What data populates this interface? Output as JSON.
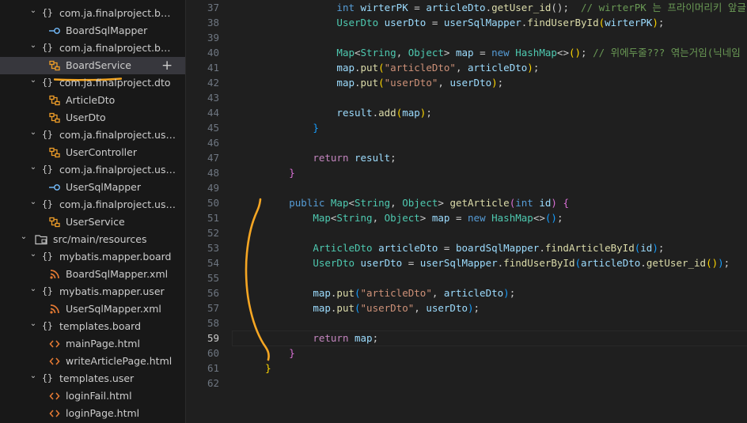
{
  "explorer": {
    "items": [
      {
        "label": "com.ja.finalproject.boar...",
        "kind": "package",
        "level": 1,
        "icon": "braces-icon"
      },
      {
        "label": "BoardSqlMapper",
        "kind": "file",
        "level": 2,
        "icon": "interface-icon",
        "icon_color": "#75beff"
      },
      {
        "label": "com.ja.finalproject.boar...",
        "kind": "package",
        "level": 1,
        "icon": "braces-icon"
      },
      {
        "label": "BoardService",
        "kind": "file",
        "level": 2,
        "icon": "class-icon",
        "icon_color": "#ee9d28",
        "selected": true,
        "action": "+"
      },
      {
        "label": "com.ja.finalproject.dto",
        "kind": "package",
        "level": 1,
        "icon": "braces-icon"
      },
      {
        "label": "ArticleDto",
        "kind": "file",
        "level": 2,
        "icon": "class-icon",
        "icon_color": "#ee9d28"
      },
      {
        "label": "UserDto",
        "kind": "file",
        "level": 2,
        "icon": "class-icon",
        "icon_color": "#ee9d28"
      },
      {
        "label": "com.ja.finalproject.user....",
        "kind": "package",
        "level": 1,
        "icon": "braces-icon"
      },
      {
        "label": "UserController",
        "kind": "file",
        "level": 2,
        "icon": "class-icon",
        "icon_color": "#ee9d28"
      },
      {
        "label": "com.ja.finalproject.user....",
        "kind": "package",
        "level": 1,
        "icon": "braces-icon"
      },
      {
        "label": "UserSqlMapper",
        "kind": "file",
        "level": 2,
        "icon": "interface-icon",
        "icon_color": "#75beff"
      },
      {
        "label": "com.ja.finalproject.user....",
        "kind": "package",
        "level": 1,
        "icon": "braces-icon"
      },
      {
        "label": "UserService",
        "kind": "file",
        "level": 2,
        "icon": "class-icon",
        "icon_color": "#ee9d28"
      },
      {
        "label": "src/main/resources",
        "kind": "folder",
        "level": 0,
        "icon": "folder-icon"
      },
      {
        "label": "mybatis.mapper.board",
        "kind": "package",
        "level": 1,
        "icon": "braces-icon"
      },
      {
        "label": "BoardSqlMapper.xml",
        "kind": "file",
        "level": 2,
        "icon": "rss-icon",
        "icon_color": "#e37933"
      },
      {
        "label": "mybatis.mapper.user",
        "kind": "package",
        "level": 1,
        "icon": "braces-icon"
      },
      {
        "label": "UserSqlMapper.xml",
        "kind": "file",
        "level": 2,
        "icon": "rss-icon",
        "icon_color": "#e37933"
      },
      {
        "label": "templates.board",
        "kind": "package",
        "level": 1,
        "icon": "braces-icon"
      },
      {
        "label": "mainPage.html",
        "kind": "file",
        "level": 2,
        "icon": "html-tag-icon",
        "icon_color": "#e37933"
      },
      {
        "label": "writeArticlePage.html",
        "kind": "file",
        "level": 2,
        "icon": "html-tag-icon",
        "icon_color": "#e37933"
      },
      {
        "label": "templates.user",
        "kind": "package",
        "level": 1,
        "icon": "braces-icon"
      },
      {
        "label": "loginFail.html",
        "kind": "file",
        "level": 2,
        "icon": "html-tag-icon",
        "icon_color": "#e37933"
      },
      {
        "label": "loginPage.html",
        "kind": "file",
        "level": 2,
        "icon": "html-tag-icon",
        "icon_color": "#e37933"
      }
    ]
  },
  "editor": {
    "current_line": 59,
    "annotation_color": "#f5a623",
    "lines": [
      {
        "n": 37,
        "tokens": [
          [
            "                ",
            "t-pun"
          ],
          [
            "int",
            "t-kw"
          ],
          [
            " ",
            "t-pun"
          ],
          [
            "wirterPK",
            "t-var"
          ],
          [
            " = ",
            "t-pun"
          ],
          [
            "articleDto",
            "t-var"
          ],
          [
            ".",
            "t-pun"
          ],
          [
            "getUser_id",
            "t-fn"
          ],
          [
            "();",
            "t-pun"
          ],
          [
            "  // wirterPK 는 프라이머리키 앞글",
            "t-com"
          ]
        ]
      },
      {
        "n": 38,
        "tokens": [
          [
            "                ",
            "t-pun"
          ],
          [
            "UserDto",
            "t-type"
          ],
          [
            " ",
            "t-pun"
          ],
          [
            "userDto",
            "t-var"
          ],
          [
            " = ",
            "t-pun"
          ],
          [
            "userSqlMapper",
            "t-var"
          ],
          [
            ".",
            "t-pun"
          ],
          [
            "findUserById",
            "t-fn"
          ],
          [
            "(",
            "t-br1"
          ],
          [
            "wirterPK",
            "t-var"
          ],
          [
            ")",
            "t-br1"
          ],
          [
            ";",
            "t-pun"
          ]
        ]
      },
      {
        "n": 39,
        "tokens": []
      },
      {
        "n": 40,
        "tokens": [
          [
            "                ",
            "t-pun"
          ],
          [
            "Map",
            "t-type"
          ],
          [
            "<",
            "t-pun"
          ],
          [
            "String",
            "t-type"
          ],
          [
            ", ",
            "t-pun"
          ],
          [
            "Object",
            "t-type"
          ],
          [
            "> ",
            "t-pun"
          ],
          [
            "map",
            "t-var"
          ],
          [
            " = ",
            "t-pun"
          ],
          [
            "new",
            "t-kw"
          ],
          [
            " ",
            "t-pun"
          ],
          [
            "HashMap",
            "t-type"
          ],
          [
            "<>",
            "t-pun"
          ],
          [
            "()",
            "t-br1"
          ],
          [
            ";",
            "t-pun"
          ],
          [
            " // 위에두줄??? 엮는거임(닉네임",
            "t-com"
          ]
        ]
      },
      {
        "n": 41,
        "tokens": [
          [
            "                ",
            "t-pun"
          ],
          [
            "map",
            "t-var"
          ],
          [
            ".",
            "t-pun"
          ],
          [
            "put",
            "t-fn"
          ],
          [
            "(",
            "t-br1"
          ],
          [
            "\"articleDto\"",
            "t-str"
          ],
          [
            ", ",
            "t-pun"
          ],
          [
            "articleDto",
            "t-var"
          ],
          [
            ")",
            "t-br1"
          ],
          [
            ";",
            "t-pun"
          ]
        ]
      },
      {
        "n": 42,
        "tokens": [
          [
            "                ",
            "t-pun"
          ],
          [
            "map",
            "t-var"
          ],
          [
            ".",
            "t-pun"
          ],
          [
            "put",
            "t-fn"
          ],
          [
            "(",
            "t-br1"
          ],
          [
            "\"userDto\"",
            "t-str"
          ],
          [
            ", ",
            "t-pun"
          ],
          [
            "userDto",
            "t-var"
          ],
          [
            ")",
            "t-br1"
          ],
          [
            ";",
            "t-pun"
          ]
        ]
      },
      {
        "n": 43,
        "tokens": []
      },
      {
        "n": 44,
        "tokens": [
          [
            "                ",
            "t-pun"
          ],
          [
            "result",
            "t-var"
          ],
          [
            ".",
            "t-pun"
          ],
          [
            "add",
            "t-fn"
          ],
          [
            "(",
            "t-br1"
          ],
          [
            "map",
            "t-var"
          ],
          [
            ")",
            "t-br1"
          ],
          [
            ";",
            "t-pun"
          ]
        ]
      },
      {
        "n": 45,
        "tokens": [
          [
            "            ",
            "t-pun"
          ],
          [
            "}",
            "t-br3"
          ]
        ]
      },
      {
        "n": 46,
        "tokens": []
      },
      {
        "n": 47,
        "tokens": [
          [
            "            ",
            "t-pun"
          ],
          [
            "return",
            "t-ctl"
          ],
          [
            " ",
            "t-pun"
          ],
          [
            "result",
            "t-var"
          ],
          [
            ";",
            "t-pun"
          ]
        ]
      },
      {
        "n": 48,
        "tokens": [
          [
            "        ",
            "t-pun"
          ],
          [
            "}",
            "t-br2"
          ]
        ]
      },
      {
        "n": 49,
        "tokens": []
      },
      {
        "n": 50,
        "tokens": [
          [
            "        ",
            "t-pun"
          ],
          [
            "public",
            "t-kw"
          ],
          [
            " ",
            "t-pun"
          ],
          [
            "Map",
            "t-type"
          ],
          [
            "<",
            "t-pun"
          ],
          [
            "String",
            "t-type"
          ],
          [
            ", ",
            "t-pun"
          ],
          [
            "Object",
            "t-type"
          ],
          [
            "> ",
            "t-pun"
          ],
          [
            "getArticle",
            "t-fn"
          ],
          [
            "(",
            "t-br2"
          ],
          [
            "int",
            "t-kw"
          ],
          [
            " ",
            "t-pun"
          ],
          [
            "id",
            "t-var"
          ],
          [
            ")",
            "t-br2"
          ],
          [
            " ",
            "t-pun"
          ],
          [
            "{",
            "t-br2"
          ]
        ]
      },
      {
        "n": 51,
        "tokens": [
          [
            "            ",
            "t-pun"
          ],
          [
            "Map",
            "t-type"
          ],
          [
            "<",
            "t-pun"
          ],
          [
            "String",
            "t-type"
          ],
          [
            ", ",
            "t-pun"
          ],
          [
            "Object",
            "t-type"
          ],
          [
            "> ",
            "t-pun"
          ],
          [
            "map",
            "t-var"
          ],
          [
            " = ",
            "t-pun"
          ],
          [
            "new",
            "t-kw"
          ],
          [
            " ",
            "t-pun"
          ],
          [
            "HashMap",
            "t-type"
          ],
          [
            "<>",
            "t-pun"
          ],
          [
            "()",
            "t-br3"
          ],
          [
            ";",
            "t-pun"
          ]
        ]
      },
      {
        "n": 52,
        "tokens": []
      },
      {
        "n": 53,
        "tokens": [
          [
            "            ",
            "t-pun"
          ],
          [
            "ArticleDto",
            "t-type"
          ],
          [
            " ",
            "t-pun"
          ],
          [
            "articleDto",
            "t-var"
          ],
          [
            " = ",
            "t-pun"
          ],
          [
            "boardSqlMapper",
            "t-var"
          ],
          [
            ".",
            "t-pun"
          ],
          [
            "findArticleById",
            "t-fn"
          ],
          [
            "(",
            "t-br3"
          ],
          [
            "id",
            "t-var"
          ],
          [
            ")",
            "t-br3"
          ],
          [
            ";",
            "t-pun"
          ]
        ]
      },
      {
        "n": 54,
        "tokens": [
          [
            "            ",
            "t-pun"
          ],
          [
            "UserDto",
            "t-type"
          ],
          [
            " ",
            "t-pun"
          ],
          [
            "userDto",
            "t-var"
          ],
          [
            " = ",
            "t-pun"
          ],
          [
            "userSqlMapper",
            "t-var"
          ],
          [
            ".",
            "t-pun"
          ],
          [
            "findUserById",
            "t-fn"
          ],
          [
            "(",
            "t-br3"
          ],
          [
            "articleDto",
            "t-var"
          ],
          [
            ".",
            "t-pun"
          ],
          [
            "getUser_id",
            "t-fn"
          ],
          [
            "()",
            "t-br1"
          ],
          [
            ")",
            "t-br3"
          ],
          [
            ";",
            "t-pun"
          ]
        ]
      },
      {
        "n": 55,
        "tokens": []
      },
      {
        "n": 56,
        "tokens": [
          [
            "            ",
            "t-pun"
          ],
          [
            "map",
            "t-var"
          ],
          [
            ".",
            "t-pun"
          ],
          [
            "put",
            "t-fn"
          ],
          [
            "(",
            "t-br3"
          ],
          [
            "\"articleDto\"",
            "t-str"
          ],
          [
            ", ",
            "t-pun"
          ],
          [
            "articleDto",
            "t-var"
          ],
          [
            ")",
            "t-br3"
          ],
          [
            ";",
            "t-pun"
          ]
        ]
      },
      {
        "n": 57,
        "tokens": [
          [
            "            ",
            "t-pun"
          ],
          [
            "map",
            "t-var"
          ],
          [
            ".",
            "t-pun"
          ],
          [
            "put",
            "t-fn"
          ],
          [
            "(",
            "t-br3"
          ],
          [
            "\"userDto\"",
            "t-str"
          ],
          [
            ", ",
            "t-pun"
          ],
          [
            "userDto",
            "t-var"
          ],
          [
            ")",
            "t-br3"
          ],
          [
            ";",
            "t-pun"
          ]
        ]
      },
      {
        "n": 58,
        "tokens": []
      },
      {
        "n": 59,
        "tokens": [
          [
            "            ",
            "t-pun"
          ],
          [
            "return",
            "t-ctl"
          ],
          [
            " ",
            "t-pun"
          ],
          [
            "map",
            "t-var"
          ],
          [
            ";",
            "t-pun"
          ]
        ]
      },
      {
        "n": 60,
        "tokens": [
          [
            "        ",
            "t-pun"
          ],
          [
            "}",
            "t-br2"
          ]
        ]
      },
      {
        "n": 61,
        "tokens": [
          [
            "    ",
            "t-pun"
          ],
          [
            "}",
            "t-br1"
          ]
        ]
      },
      {
        "n": 62,
        "tokens": []
      }
    ]
  }
}
